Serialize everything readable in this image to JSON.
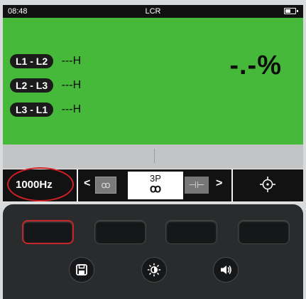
{
  "status": {
    "time": "08:48",
    "mode_title": "LCR",
    "battery_level": 0.6
  },
  "readings": [
    {
      "pair": "L1 - L2",
      "value": "---H"
    },
    {
      "pair": "L2 - L3",
      "value": "---H"
    },
    {
      "pair": "L3 - L1",
      "value": "---H"
    }
  ],
  "imbalance": "-.-%",
  "softkeys": {
    "frequency": "1000Hz",
    "prev_arrow": "<",
    "next_arrow": ">",
    "selected_mode_label": "3P",
    "selected_mode_icon": "coil-icon",
    "left_mode_icon": "coil-icon",
    "right_mode_icon": "capacitor-icon",
    "right_cell_icon": "crosshair-icon"
  },
  "keypad": {
    "function_keys": 4,
    "selected_key": 1,
    "round_buttons": [
      "save-icon",
      "brightness-icon",
      "volume-icon"
    ]
  },
  "colors": {
    "screen_background": "#46b93a",
    "highlight_ring": "#d21f26",
    "keypad": "#2a2b2d"
  }
}
